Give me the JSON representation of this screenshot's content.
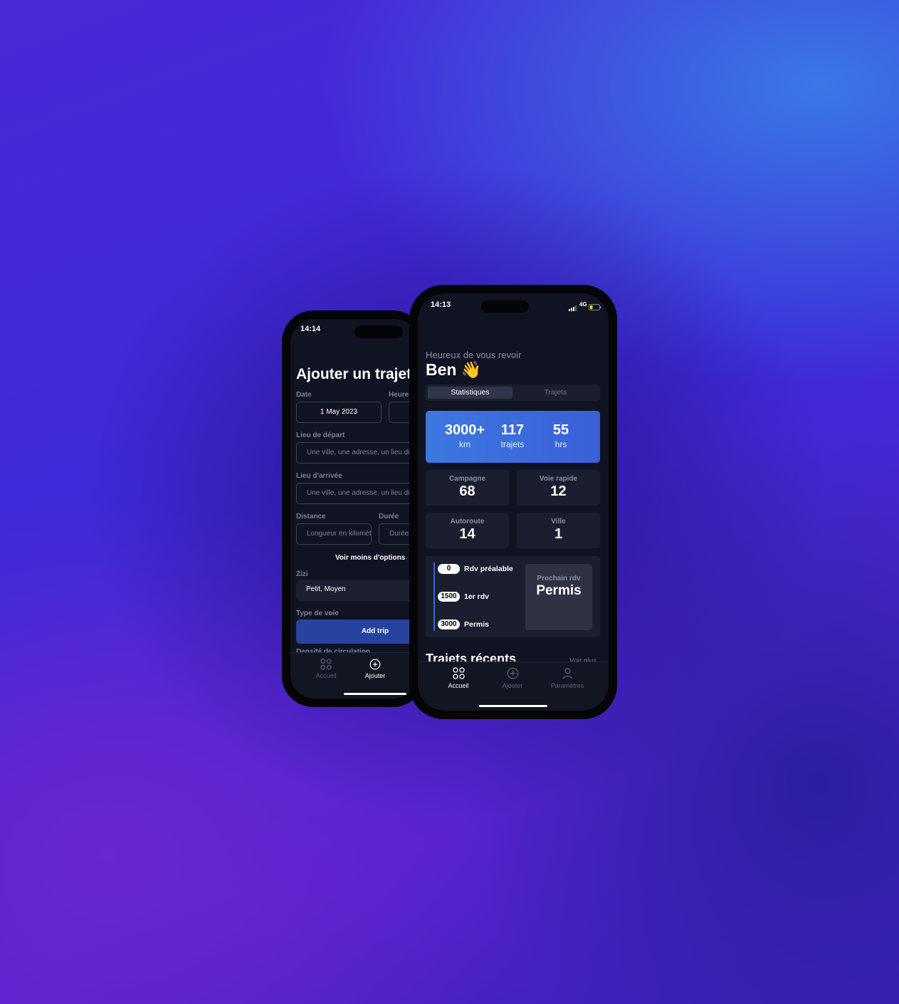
{
  "back_phone": {
    "status_time": "14:14",
    "title": "Ajouter un trajet",
    "date_label": "Date",
    "date_value": "1 May 2023",
    "heure_label": "Heure",
    "depart_label": "Lieu de départ",
    "depart_placeholder": "Une ville, une adresse, un lieu dit",
    "arrivee_label": "Lieu d'arrivée",
    "arrivee_placeholder": "Une ville, une adresse, un lieu dit",
    "distance_label": "Distance",
    "distance_placeholder": "Longueur en kilomètres",
    "duree_label": "Durée",
    "duree_placeholder": "Durée",
    "options_toggle": "Voir moins d'options",
    "zizi_label": "Zizi",
    "zizi_value": "Petit, Moyen",
    "type_voie_label": "Type de voie",
    "add_trip_button": "Add trip",
    "densite_label": "Densité de circulation",
    "nav": {
      "accueil": "Accueil",
      "ajouter": "Ajouter"
    }
  },
  "front_phone": {
    "status_time": "14:13",
    "network": "4G",
    "greeting": "Heureux de vous revoir",
    "user_name": "Ben 👋",
    "tabs": {
      "stats": "Statistiques",
      "trips": "Trajets"
    },
    "summary": [
      {
        "value": "3000+",
        "unit": "km"
      },
      {
        "value": "117",
        "unit": "trajets"
      },
      {
        "value": "55",
        "unit": "hrs"
      }
    ],
    "road_stats": [
      {
        "label": "Campagne",
        "value": "68"
      },
      {
        "label": "Voie rapide",
        "value": "12"
      },
      {
        "label": "Autoroute",
        "value": "14"
      },
      {
        "label": "Ville",
        "value": "1"
      }
    ],
    "milestones": [
      {
        "km": "0",
        "label": "Rdv préalable"
      },
      {
        "km": "1500",
        "label": "1er rdv"
      },
      {
        "km": "3000",
        "label": "Permis"
      }
    ],
    "next_rdv_label": "Prochain rdv",
    "next_rdv_value": "Permis",
    "recent_title": "Trajets récents",
    "see_more": "Voir plus",
    "nav": {
      "accueil": "Accueil",
      "ajouter": "Ajouter",
      "parametres": "Paramètres"
    }
  }
}
